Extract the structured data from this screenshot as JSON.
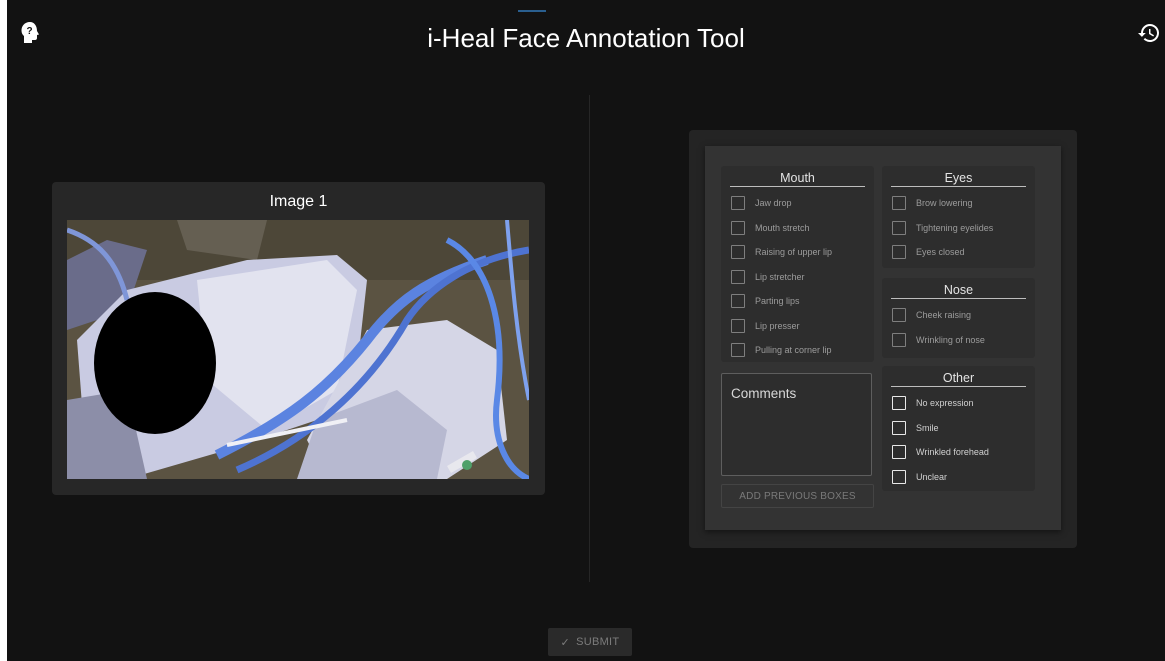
{
  "app": {
    "title": "i-Heal Face Annotation Tool"
  },
  "icons": {
    "help": "help-head-icon",
    "history": "history-icon",
    "submit": "check-icon"
  },
  "image_card": {
    "title": "Image 1"
  },
  "groups": {
    "mouth": {
      "title": "Mouth",
      "items": [
        "Jaw drop",
        "Mouth stretch",
        "Raising of upper lip",
        "Lip stretcher",
        "Parting lips",
        "Lip presser",
        "Pulling at corner lip"
      ]
    },
    "eyes": {
      "title": "Eyes",
      "items": [
        "Brow lowering",
        "Tightening eyelides",
        "Eyes closed"
      ]
    },
    "nose": {
      "title": "Nose",
      "items": [
        "Cheek raising",
        "Wrinkling of nose"
      ]
    },
    "other": {
      "title": "Other",
      "items": [
        "No expression",
        "Smile",
        "Wrinkled forehead",
        "Unclear"
      ]
    }
  },
  "comments": {
    "placeholder": "Comments"
  },
  "buttons": {
    "add_previous": "ADD PREVIOUS BOXES",
    "submit": "SUBMIT"
  },
  "colors": {
    "background": "#121212",
    "panel": "#333333",
    "card": "#272727"
  }
}
